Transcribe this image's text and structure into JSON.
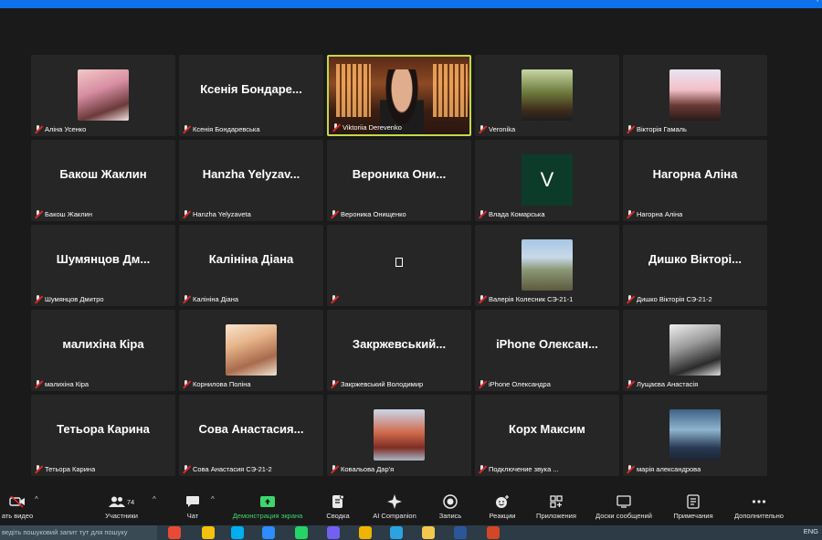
{
  "window": {
    "title_glyph": "'"
  },
  "tiles": [
    {
      "big": "",
      "foot": "Аліна Усенко",
      "kind": "image",
      "img": "av1"
    },
    {
      "big": "Ксенія Бондаре...",
      "foot": "Ксенія Бондаревська",
      "kind": "name"
    },
    {
      "big": "",
      "foot": "Viktoriia Derevenko",
      "kind": "video",
      "active": true
    },
    {
      "big": "",
      "foot": "Veronika",
      "kind": "image",
      "img": "av4"
    },
    {
      "big": "",
      "foot": "Вікторія Гамаль",
      "kind": "image",
      "img": "av5"
    },
    {
      "big": "Бакош Жаклин",
      "foot": "Бакош Жаклин",
      "kind": "name"
    },
    {
      "big": "Hanzha Yelyzav...",
      "foot": "Hanzha Yelyzaveta",
      "kind": "name"
    },
    {
      "big": "Вероника Они...",
      "foot": "Вероника Онищенко",
      "kind": "name"
    },
    {
      "big": "",
      "foot": "Влада Комарська",
      "kind": "letter",
      "letter": "V"
    },
    {
      "big": "Нагорна Аліна",
      "foot": "Нагорна Аліна",
      "kind": "name"
    },
    {
      "big": "Шумянцов Дм...",
      "foot": "Шумянцов Дмитро",
      "kind": "name"
    },
    {
      "big": "Калініна Діана",
      "foot": "Калініна Діана",
      "kind": "name"
    },
    {
      "big": "",
      "foot": "",
      "kind": "glyph"
    },
    {
      "big": "",
      "foot": "Валерія Колесник СЭ-21-1",
      "kind": "image",
      "img": "av-rock"
    },
    {
      "big": "Дишко Вікторі...",
      "foot": "Дишко Вікторія СЭ-21-2",
      "kind": "name"
    },
    {
      "big": "малихіна Кіра",
      "foot": "малихіна Кіра",
      "kind": "name"
    },
    {
      "big": "",
      "foot": "Корнилова Поліна",
      "kind": "image",
      "img": "av-anime1"
    },
    {
      "big": "Закржевський...",
      "foot": "Закржевський Володимир",
      "kind": "name"
    },
    {
      "big": "iPhone Олексан...",
      "foot": "iPhone Олександра",
      "kind": "name"
    },
    {
      "big": "",
      "foot": "Лущаєва Анастасія",
      "kind": "image",
      "img": "av-anime2"
    },
    {
      "big": "Тетьора Карина",
      "foot": "Тетьора Карина",
      "kind": "name"
    },
    {
      "big": "Сова Анастасия...",
      "foot": "Сова Анастасия СЭ-21-2",
      "kind": "name"
    },
    {
      "big": "",
      "foot": "Ковальова Дар'я",
      "kind": "image",
      "img": "av-red"
    },
    {
      "big": "Корх Максим",
      "foot": "Подключение звука ...",
      "kind": "name"
    },
    {
      "big": "",
      "foot": "марія александрова",
      "kind": "image",
      "img": "av-blue"
    }
  ],
  "toolbar": {
    "video_label": "ать видео",
    "participants_label": "Участники",
    "participants_count": "74",
    "chat_label": "Чат",
    "share_label": "Демонстрация экрана",
    "summary_label": "Сводка",
    "companion_label": "AI Companion",
    "record_label": "Запись",
    "reactions_label": "Реакции",
    "apps_label": "Приложения",
    "whiteboards_label": "Доски сообщений",
    "notes_label": "Примечания",
    "more_label": "Дополнительно",
    "caret": "^",
    "icons": [
      "video-off-icon",
      "participants-icon",
      "chat-icon",
      "share-screen-icon",
      "summary-icon",
      "ai-companion-icon",
      "record-icon",
      "reactions-icon",
      "apps-icon",
      "whiteboards-icon",
      "notes-icon",
      "more-icon"
    ]
  },
  "taskbar": {
    "search_text": "ведіть пошуковий запит тут для пошуку",
    "tray_text": "ENG"
  },
  "colors": {
    "accent": "#0e72ed",
    "active_border": "#c3d84d",
    "share_green": "#3ed66b",
    "tile_bg": "#262626",
    "muted_red": "#e02828"
  }
}
